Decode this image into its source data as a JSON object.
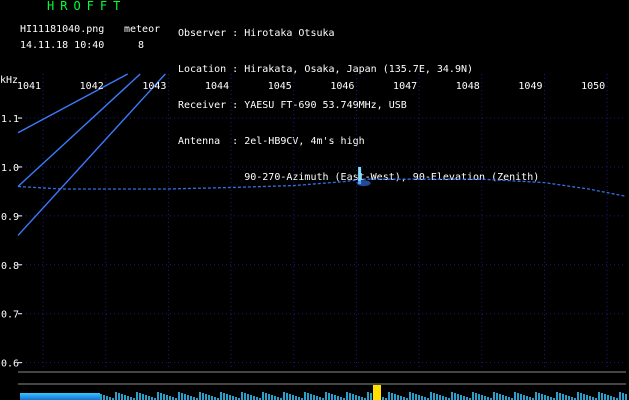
{
  "header": {
    "brand": "HROFFT",
    "filename": "HI11181040.png",
    "timestamp": "14.11.18 10:40",
    "meteor_label": "meteor",
    "meteor_count": "8",
    "info_lines": [
      "Observer : Hirotaka Otsuka",
      "Location : Hirakata, Osaka, Japan (135.7E, 34.9N)",
      "Receiver : YAESU FT-690 53.749MHz, USB",
      "Antenna  : 2el-HB9CV, 4m's high",
      "           90-270-Azimuth (East-West), 90-Elevation (Zenith)"
    ]
  },
  "chart_data": {
    "type": "heatmap",
    "ylabel": "kHz",
    "x_ticks": [
      "1041",
      "1042",
      "1043",
      "1044",
      "1045",
      "1046",
      "1047",
      "1048",
      "1049",
      "1050"
    ],
    "y_ticks": [
      "1.1",
      "1.0",
      "0.9",
      "0.8",
      "0.7",
      "0.6"
    ],
    "x_range": [
      1040.6,
      1050.3
    ],
    "y_range": [
      0.585,
      1.19
    ],
    "grid": true,
    "colors": {
      "background": "#000000",
      "grid": "#1a1a80",
      "signal": "#3a7bff",
      "head": "#7fe0ff",
      "bars": "#33c8ff",
      "peak": "#ffe000"
    },
    "diagonal_lines": [
      {
        "x": [
          1040.6,
          1042.35
        ],
        "y": [
          1.07,
          1.19
        ]
      },
      {
        "x": [
          1040.6,
          1042.55
        ],
        "y": [
          0.96,
          1.19
        ]
      },
      {
        "x": [
          1040.6,
          1042.95
        ],
        "y": [
          0.86,
          1.19
        ]
      }
    ],
    "meteor_head": {
      "x": 1046.05,
      "y_top": 1.0,
      "y_bottom": 0.965
    },
    "meteor_trail": {
      "x": [
        1040.6,
        1041.3,
        1042.0,
        1043.0,
        1044.0,
        1045.0,
        1045.8,
        1046.1,
        1046.5,
        1047.0,
        1048.0,
        1049.0,
        1049.7,
        1050.3
      ],
      "y": [
        0.96,
        0.955,
        0.955,
        0.955,
        0.958,
        0.962,
        0.97,
        0.975,
        0.975,
        0.975,
        0.975,
        0.968,
        0.955,
        0.94
      ]
    }
  }
}
